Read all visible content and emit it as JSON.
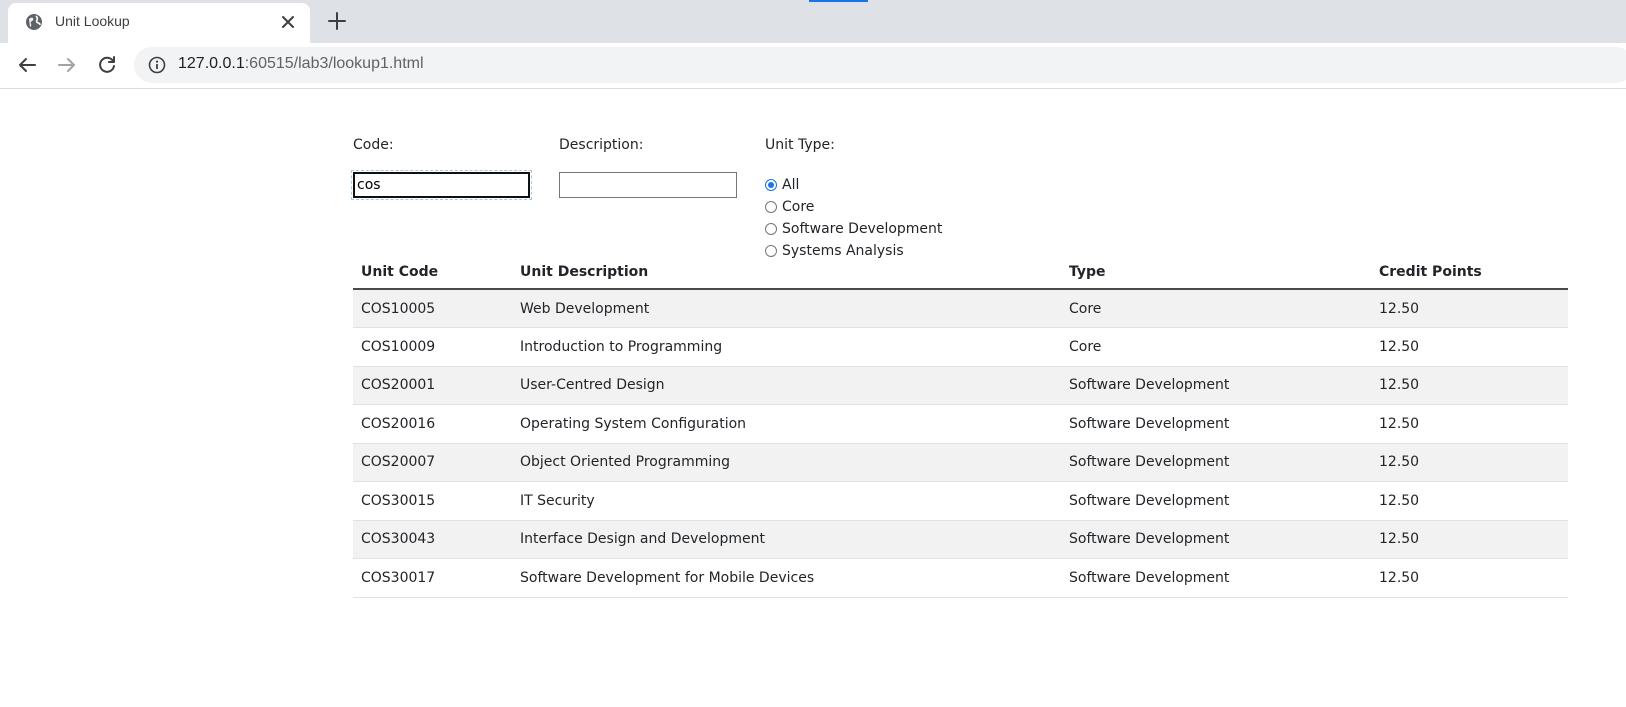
{
  "browser": {
    "tab_title": "Unit Lookup",
    "tab_icon": "globe-icon",
    "url_host": "127.0.0.1",
    "url_rest": ":60515/lab3/lookup1.html",
    "accent_color": "#1a73e8"
  },
  "form": {
    "code_label": "Code:",
    "code_value": "cos",
    "description_label": "Description:",
    "description_value": "",
    "unit_type_label": "Unit Type:",
    "unit_type_options": [
      {
        "label": "All",
        "checked": true
      },
      {
        "label": "Core",
        "checked": false
      },
      {
        "label": "Software Development",
        "checked": false
      },
      {
        "label": "Systems Analysis",
        "checked": false
      }
    ]
  },
  "table": {
    "headers": [
      "Unit Code",
      "Unit Description",
      "Type",
      "Credit Points"
    ],
    "rows": [
      [
        "COS10005",
        "Web Development",
        "Core",
        "12.50"
      ],
      [
        "COS10009",
        "Introduction to Programming",
        "Core",
        "12.50"
      ],
      [
        "COS20001",
        "User-Centred Design",
        "Software Development",
        "12.50"
      ],
      [
        "COS20016",
        "Operating System Configuration",
        "Software Development",
        "12.50"
      ],
      [
        "COS20007",
        "Object Oriented Programming",
        "Software Development",
        "12.50"
      ],
      [
        "COS30015",
        "IT Security",
        "Software Development",
        "12.50"
      ],
      [
        "COS30043",
        "Interface Design and Development",
        "Software Development",
        "12.50"
      ],
      [
        "COS30017",
        "Software Development for Mobile Devices",
        "Software Development",
        "12.50"
      ]
    ]
  }
}
